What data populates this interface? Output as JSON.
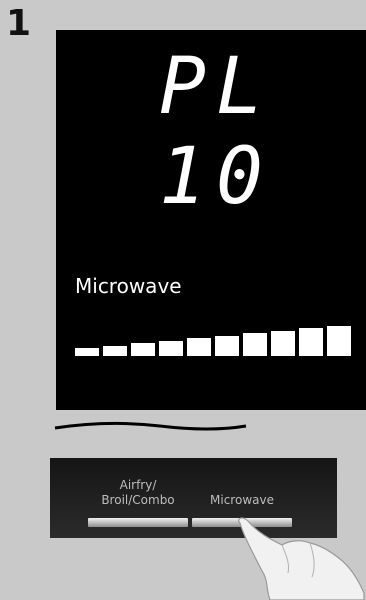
{
  "step": {
    "number": "1"
  },
  "display": {
    "code_text": "PL 10",
    "mode_label": "Microwave",
    "power_level": {
      "filled": 10,
      "total": 10
    }
  },
  "panel": {
    "buttons": [
      {
        "label_line1": "Airfry/",
        "label_line2": "Broil/Combo"
      },
      {
        "label_line1": "Microwave",
        "label_line2": ""
      }
    ]
  },
  "colors": {
    "display_bg": "#000000",
    "segment": "#ffffff",
    "panel_bg": "#1e1e1e",
    "page_bg": "#c9c9c9"
  }
}
